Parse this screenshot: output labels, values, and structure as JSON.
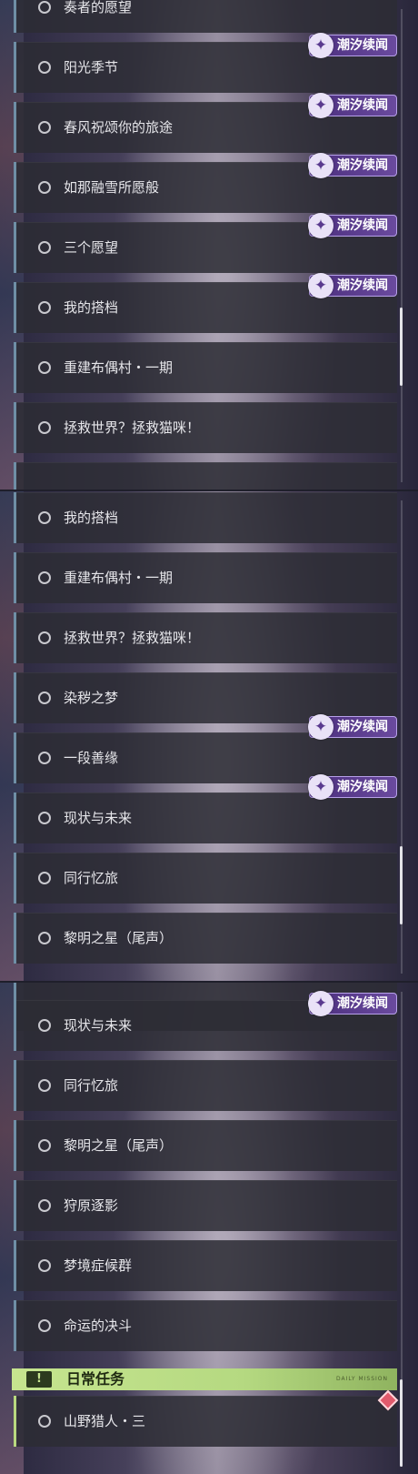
{
  "tag_label": "潮汐续闻",
  "panel1": {
    "quests": [
      {
        "label": "奏者的愿望",
        "tag": false
      },
      {
        "label": "阳光季节",
        "tag": true
      },
      {
        "label": "春风祝颂你的旅途",
        "tag": true
      },
      {
        "label": "如那融雪所愿般",
        "tag": true
      },
      {
        "label": "三个愿望",
        "tag": true
      },
      {
        "label": "我的搭档",
        "tag": true
      },
      {
        "label": "重建布偶村・一期",
        "tag": false
      },
      {
        "label": "拯救世界？拯救猫咪！",
        "tag": false
      }
    ]
  },
  "panel2": {
    "quests": [
      {
        "label": "我的搭档",
        "tag": false
      },
      {
        "label": "重建布偶村・一期",
        "tag": false
      },
      {
        "label": "拯救世界？拯救猫咪！",
        "tag": false
      },
      {
        "label": "染秽之梦",
        "tag": false
      },
      {
        "label": "一段善缘",
        "tag": true
      },
      {
        "label": "现状与未来",
        "tag": true
      },
      {
        "label": "同行忆旅",
        "tag": false
      },
      {
        "label": "黎明之星（尾声）",
        "tag": false
      }
    ]
  },
  "panel3": {
    "quests": [
      {
        "label": "现状与未来",
        "tag": true
      },
      {
        "label": "同行忆旅",
        "tag": false
      },
      {
        "label": "黎明之星（尾声）",
        "tag": false
      },
      {
        "label": "狩原逐影",
        "tag": false
      },
      {
        "label": "梦境症候群",
        "tag": false
      },
      {
        "label": "命运的决斗",
        "tag": false
      }
    ]
  },
  "daily": {
    "icon": "!",
    "title": "日常任务",
    "subtitle": "DAILY MISSION",
    "quests": [
      {
        "label": "山野猎人・三"
      }
    ]
  },
  "colors": {
    "accent_blue": "#6f8fa6",
    "tag_purple": "#5b3b8f",
    "daily_green": "#c6e58f",
    "marker_red": "#e05a6c"
  }
}
